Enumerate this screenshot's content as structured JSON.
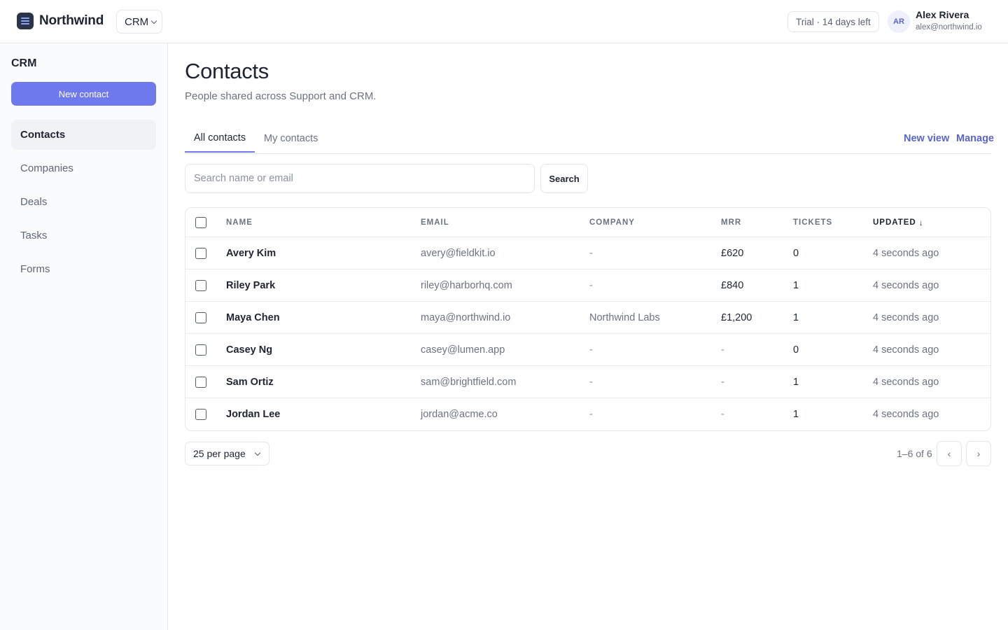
{
  "header": {
    "brand": "Northwind",
    "app_switcher": "CRM",
    "trial_badge": "Trial · 14 days left",
    "user": {
      "initials": "AR",
      "name": "Alex Rivera",
      "email": "alex@northwind.io"
    }
  },
  "sidebar": {
    "title": "CRM",
    "new_button": "New contact",
    "items": [
      {
        "label": "Contacts",
        "active": true
      },
      {
        "label": "Companies"
      },
      {
        "label": "Deals"
      },
      {
        "label": "Tasks"
      },
      {
        "label": "Forms"
      }
    ]
  },
  "main": {
    "title": "Contacts",
    "subtitle": "People shared across Support and CRM.",
    "tabs": [
      {
        "label": "All contacts",
        "active": true
      },
      {
        "label": "My contacts"
      }
    ],
    "view_links": {
      "new_view": "New view",
      "manage": "Manage"
    },
    "search": {
      "placeholder": "Search name or email",
      "value": "",
      "button": "Search"
    },
    "table": {
      "columns": [
        "Name",
        "Email",
        "Company",
        "MRR",
        "Tickets",
        "Updated"
      ],
      "sort_indicator": "↓",
      "rows": [
        {
          "name": "Avery Kim",
          "email": "avery@fieldkit.io",
          "company": "-",
          "mrr": "£620",
          "tickets": "0",
          "updated": "4 seconds ago"
        },
        {
          "name": "Riley Park",
          "email": "riley@harborhq.com",
          "company": "-",
          "mrr": "£840",
          "tickets": "1",
          "updated": "4 seconds ago"
        },
        {
          "name": "Maya Chen",
          "email": "maya@northwind.io",
          "company": "Northwind Labs",
          "mrr": "£1,200",
          "tickets": "1",
          "updated": "4 seconds ago"
        },
        {
          "name": "Casey Ng",
          "email": "casey@lumen.app",
          "company": "-",
          "mrr": "-",
          "tickets": "0",
          "updated": "4 seconds ago"
        },
        {
          "name": "Sam Ortiz",
          "email": "sam@brightfield.com",
          "company": "-",
          "mrr": "-",
          "tickets": "1",
          "updated": "4 seconds ago"
        },
        {
          "name": "Jordan Lee",
          "email": "jordan@acme.co",
          "company": "-",
          "mrr": "-",
          "tickets": "1",
          "updated": "4 seconds ago"
        }
      ]
    },
    "pagination": {
      "per_page": "25 per page",
      "range": "1–6 of 6",
      "prev": "‹",
      "next": "›"
    }
  },
  "colors": {
    "accent": "#6e79ee",
    "text": "#1f2433",
    "muted": "#6b7282",
    "border": "#e6e8ee"
  },
  "icons": {
    "logo": "stack-logo-icon",
    "chevron": "chevron-down-icon",
    "prev": "chevron-left-icon",
    "next": "chevron-right-icon"
  }
}
